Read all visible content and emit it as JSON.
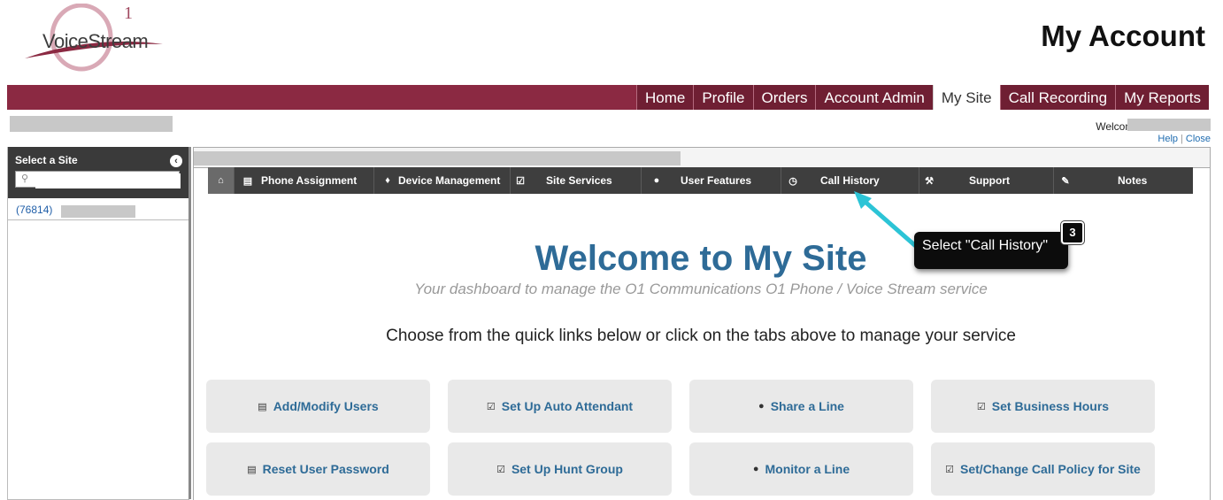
{
  "logo": {
    "text": "VoiceStream",
    "superscript": "1"
  },
  "header": {
    "title": "My Account"
  },
  "topnav": {
    "tabs": [
      "Home",
      "Profile",
      "Orders",
      "Account Admin",
      "My Site",
      "Call Recording",
      "My Reports"
    ],
    "active": "My Site"
  },
  "account_bar": {
    "welcome_label": "Welcome",
    "help_label": "Help",
    "separator": "|",
    "close_label": "Close"
  },
  "sidebar": {
    "title": "Select a Site",
    "search_placeholder": "",
    "sites": [
      {
        "id": "(76814)"
      }
    ]
  },
  "subnav": {
    "tabs": [
      {
        "label": "Phone Assignment",
        "icon": "list-icon"
      },
      {
        "label": "Device Management",
        "icon": "bell-icon"
      },
      {
        "label": "Site Services",
        "icon": "edit-icon"
      },
      {
        "label": "User Features",
        "icon": "user-icon"
      },
      {
        "label": "Call History",
        "icon": "clock-icon"
      },
      {
        "label": "Support",
        "icon": "wrench-icon"
      },
      {
        "label": "Notes",
        "icon": "pencil-icon"
      }
    ]
  },
  "content": {
    "title": "Welcome to My Site",
    "subtitle": "Your dashboard to manage the O1 Communications O1 Phone / Voice Stream service",
    "instruction": "Choose from the quick links below or click on the tabs above to manage your service"
  },
  "quick_links": [
    {
      "label": "Add/Modify Users",
      "icon": "list-icon"
    },
    {
      "label": "Set Up Auto Attendant",
      "icon": "edit-icon"
    },
    {
      "label": "Share a Line",
      "icon": "user-icon"
    },
    {
      "label": "Set Business Hours",
      "icon": "edit-icon"
    },
    {
      "label": "Reset User Password",
      "icon": "list-icon"
    },
    {
      "label": "Set Up Hunt Group",
      "icon": "edit-icon"
    },
    {
      "label": "Monitor a Line",
      "icon": "user-icon"
    },
    {
      "label": "Set/Change Call Policy for Site",
      "icon": "edit-icon"
    }
  ],
  "callout": {
    "step": "3",
    "text": "Select \"Call History\""
  },
  "colors": {
    "brand_maroon": "#8b2942",
    "link_blue": "#2e6b97",
    "subnav_dark": "#3e3e3e",
    "arrow_cyan": "#2cc4d6"
  }
}
